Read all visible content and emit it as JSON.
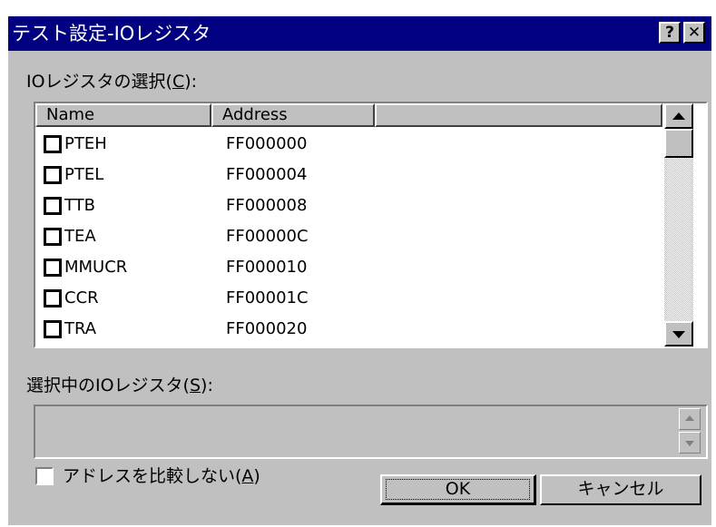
{
  "window": {
    "title": "テスト設定-IOレジスタ",
    "help_label": "?",
    "close_label": "✕"
  },
  "register_list": {
    "label": "IOレジスタの選択(",
    "label_key": "C",
    "label_end": "):",
    "columns": [
      "Name",
      "Address",
      ""
    ],
    "rows": [
      {
        "name": "PTEH",
        "address": "FF000000",
        "checked": false
      },
      {
        "name": "PTEL",
        "address": "FF000004",
        "checked": false
      },
      {
        "name": "TTB",
        "address": "FF000008",
        "checked": false
      },
      {
        "name": "TEA",
        "address": "FF00000C",
        "checked": false
      },
      {
        "name": "MMUCR",
        "address": "FF000010",
        "checked": false
      },
      {
        "name": "CCR",
        "address": "FF00001C",
        "checked": false
      },
      {
        "name": "TRA",
        "address": "FF000020",
        "checked": false
      }
    ]
  },
  "selected_list": {
    "label": "選択中のIOレジスタ(",
    "label_key": "S",
    "label_end": "):"
  },
  "compare_option": {
    "label": "アドレスを比較しない(",
    "label_key": "A",
    "label_end": ")",
    "checked": false
  },
  "buttons": {
    "ok": "OK",
    "cancel": "キャンセル"
  },
  "colors": {
    "titlebar": "#000080",
    "face": "#c0c0c0"
  }
}
